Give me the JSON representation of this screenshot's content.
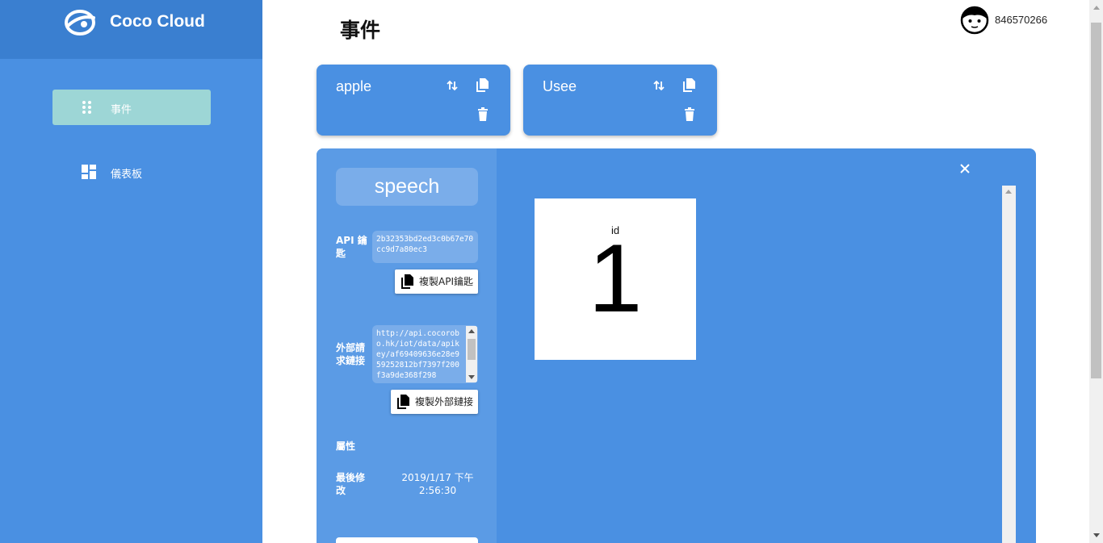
{
  "brand": {
    "name": "Coco Cloud"
  },
  "sidebar": {
    "items": [
      {
        "label": "事件",
        "icon": "dots-grid-icon",
        "active": true
      },
      {
        "label": "儀表板",
        "icon": "dashboard-icon",
        "active": false
      }
    ]
  },
  "header": {
    "title": "事件",
    "user_id": "846570266"
  },
  "devices": [
    {
      "name": "apple"
    },
    {
      "name": "Usee"
    }
  ],
  "event": {
    "name": "speech",
    "api_key_label": "API 鑰匙",
    "api_key": "2b32353bd2ed3c0b67e70cc9d7a80ec3",
    "copy_api_key_label": "複製API鑰匙",
    "external_link_label": "外部請求鏈接",
    "external_link": "http://api.cocorobo.hk/iot/data/apikey/af69409636e28e959252812bf7397f200f3a9de368f298",
    "copy_external_link_label": "複製外部鏈接",
    "properties_label": "屬性",
    "last_modified_label": "最後修改",
    "last_modified_value": "2019/1/17 下午2:56:30"
  },
  "widget": {
    "label": "id",
    "value": "1"
  },
  "colors": {
    "primary": "#4a90e2",
    "brand_bar": "#3a7fd0",
    "active_nav": "#9dd6d6",
    "panel_left": "#5b9be5"
  }
}
